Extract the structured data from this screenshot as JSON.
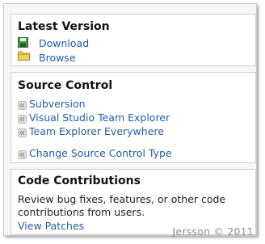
{
  "latest_version": {
    "title": "Latest Version",
    "download_label": "Download",
    "browse_label": "Browse"
  },
  "source_control": {
    "title": "Source Control",
    "items": [
      {
        "label": "Subversion"
      },
      {
        "label": "Visual Studio Team Explorer"
      },
      {
        "label": "Team Explorer Everywhere"
      },
      {
        "label": "Change Source Control Type"
      }
    ]
  },
  "code_contributions": {
    "title": "Code Contributions",
    "description_line1": "Review bug fixes, features, or other code",
    "description_line2": "contributions from users.",
    "view_patches_label": "View Patches"
  },
  "watermark": "Jersson © 2011",
  "icons": {
    "download": "floppy-disk-icon",
    "browse": "folder-icon",
    "source_item": "double-chevron-left-icon"
  },
  "colors": {
    "link": "#2a58a8",
    "heading": "#111111",
    "panel_border": "#cfcfcf"
  }
}
